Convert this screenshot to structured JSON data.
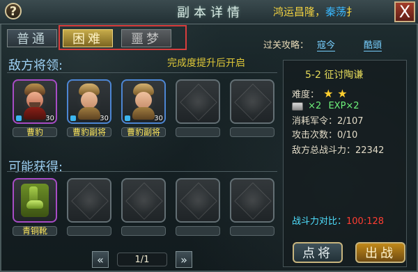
{
  "header": {
    "help_symbol": "?",
    "title": "副本详情",
    "banner_prefix": "鸿运昌隆，",
    "banner_name": "秦荡",
    "banner_suffix": "扌",
    "close_symbol": "X"
  },
  "tabs": [
    {
      "label": "普通"
    },
    {
      "label": "困难"
    },
    {
      "label": "噩梦"
    }
  ],
  "guide": {
    "label": "过关攻略：",
    "links": [
      "寇今",
      "酷頭"
    ]
  },
  "enemy_section": {
    "title": "敌方将领:",
    "notice": "完成度提升后开启",
    "cards": [
      {
        "name": "曹豹",
        "level": "30"
      },
      {
        "name": "曹豹副将",
        "level": "30"
      },
      {
        "name": "曹豹副将",
        "level": "30"
      },
      {
        "name": ""
      },
      {
        "name": ""
      }
    ]
  },
  "reward_section": {
    "title": "可能获得:",
    "items": [
      {
        "name": "青铜靴"
      },
      {
        "name": ""
      },
      {
        "name": ""
      },
      {
        "name": ""
      },
      {
        "name": ""
      }
    ],
    "pager": "1/1",
    "prev_symbol": "«",
    "next_symbol": "»"
  },
  "details": {
    "stage": "5-2 征讨陶谦",
    "difficulty_label": "难度：",
    "rewards_text": "×2",
    "exp_text": "EXP×2",
    "cost_label": "消耗军令：",
    "cost_value": "2/107",
    "attack_label": "攻击次数：",
    "attack_value": "0/10",
    "power_label": "敌方总战斗力：",
    "power_value": "22342",
    "compare_label": "战斗力对比：",
    "compare_value": "100:128"
  },
  "actions": {
    "recruit": "点将",
    "battle": "出战"
  }
}
